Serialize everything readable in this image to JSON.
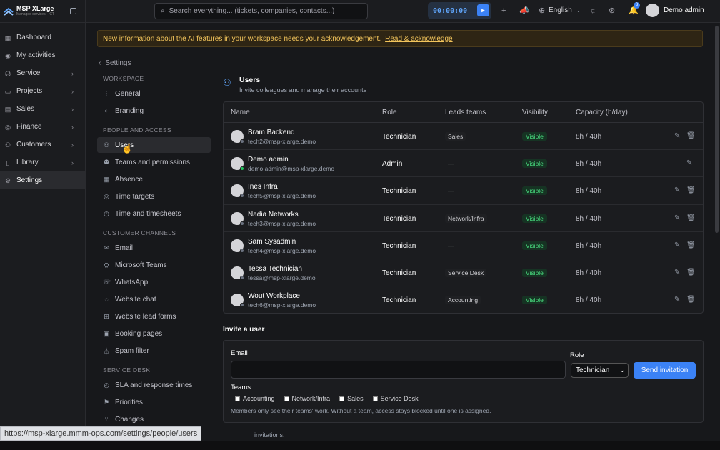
{
  "brand": {
    "name": "MSP XLarge",
    "sub": "Managed services · ICT"
  },
  "nav": [
    {
      "label": "Dashboard",
      "icon": "grid",
      "chev": false
    },
    {
      "label": "My activities",
      "icon": "eye",
      "chev": false
    },
    {
      "label": "Service",
      "icon": "headset",
      "chev": true
    },
    {
      "label": "Projects",
      "icon": "folder",
      "chev": true
    },
    {
      "label": "Sales",
      "icon": "chart",
      "chev": true
    },
    {
      "label": "Finance",
      "icon": "coins",
      "chev": true
    },
    {
      "label": "Customers",
      "icon": "people",
      "chev": true
    },
    {
      "label": "Library",
      "icon": "book",
      "chev": true
    },
    {
      "label": "Settings",
      "icon": "gear",
      "chev": false
    }
  ],
  "topbar": {
    "search_placeholder": "Search everything... (tickets, companies, contacts...)",
    "timer": "00:00:00",
    "language": "English",
    "notifications": "3",
    "user": "Demo admin"
  },
  "banner": {
    "text": "New information about the AI features in your workspace needs your acknowledgement.",
    "link": "Read & acknowledge"
  },
  "settings": {
    "back": "Settings",
    "sections": {
      "workspace": "WORKSPACE",
      "people": "PEOPLE AND ACCESS",
      "channels": "CUSTOMER CHANNELS",
      "servicedesk": "SERVICE DESK"
    },
    "items": {
      "general": "General",
      "branding": "Branding",
      "users": "Users",
      "teams": "Teams and permissions",
      "absence": "Absence",
      "time_targets": "Time targets",
      "timesheets": "Time and timesheets",
      "email": "Email",
      "msteams": "Microsoft Teams",
      "whatsapp": "WhatsApp",
      "webchat": "Website chat",
      "leadforms": "Website lead forms",
      "booking": "Booking pages",
      "spam": "Spam filter",
      "sla": "SLA and response times",
      "priorities": "Priorities",
      "changes": "Changes"
    }
  },
  "main": {
    "title": "Users",
    "subtitle": "Invite colleagues and manage their accounts",
    "columns": {
      "name": "Name",
      "role": "Role",
      "leads": "Leads teams",
      "visibility": "Visibility",
      "capacity": "Capacity (h/day)"
    },
    "users": [
      {
        "name": "Bram Backend",
        "email": "tech2@msp-xlarge.demo",
        "role": "Technician",
        "leads": "Sales",
        "visibility": "Visible",
        "capacity": "8h / 40h",
        "online": false,
        "deletable": true
      },
      {
        "name": "Demo admin",
        "email": "demo.admin@msp-xlarge.demo",
        "role": "Admin",
        "leads": "—",
        "visibility": "Visible",
        "capacity": "8h / 40h",
        "online": true,
        "deletable": false
      },
      {
        "name": "Ines Infra",
        "email": "tech5@msp-xlarge.demo",
        "role": "Technician",
        "leads": "—",
        "visibility": "Visible",
        "capacity": "8h / 40h",
        "online": false,
        "deletable": true
      },
      {
        "name": "Nadia Networks",
        "email": "tech3@msp-xlarge.demo",
        "role": "Technician",
        "leads": "Network/Infra",
        "visibility": "Visible",
        "capacity": "8h / 40h",
        "online": false,
        "deletable": true
      },
      {
        "name": "Sam Sysadmin",
        "email": "tech4@msp-xlarge.demo",
        "role": "Technician",
        "leads": "—",
        "visibility": "Visible",
        "capacity": "8h / 40h",
        "online": false,
        "deletable": true
      },
      {
        "name": "Tessa Technician",
        "email": "tessa@msp-xlarge.demo",
        "role": "Technician",
        "leads": "Service Desk",
        "visibility": "Visible",
        "capacity": "8h / 40h",
        "online": false,
        "deletable": true
      },
      {
        "name": "Wout Workplace",
        "email": "tech6@msp-xlarge.demo",
        "role": "Technician",
        "leads": "Accounting",
        "visibility": "Visible",
        "capacity": "8h / 40h",
        "online": false,
        "deletable": true
      }
    ]
  },
  "invite": {
    "title": "Invite a user",
    "email_label": "Email",
    "email_value": "",
    "role_label": "Role",
    "role_value": "Technician",
    "send_label": "Send invitation",
    "teams_label": "Teams",
    "teams": [
      "Accounting",
      "Network/Infra",
      "Sales",
      "Service Desk"
    ],
    "hint": "Members only see their teams' work. Without a team, access stays blocked until one is assigned.",
    "pending_partial": "invitations."
  },
  "statusbar": {
    "url": "https://msp-xlarge.mmm-ops.com/settings/people/users"
  },
  "colors": {
    "accent": "#3b82f6",
    "visible_badge": "#4ade80",
    "banner": "#f3c55c"
  }
}
